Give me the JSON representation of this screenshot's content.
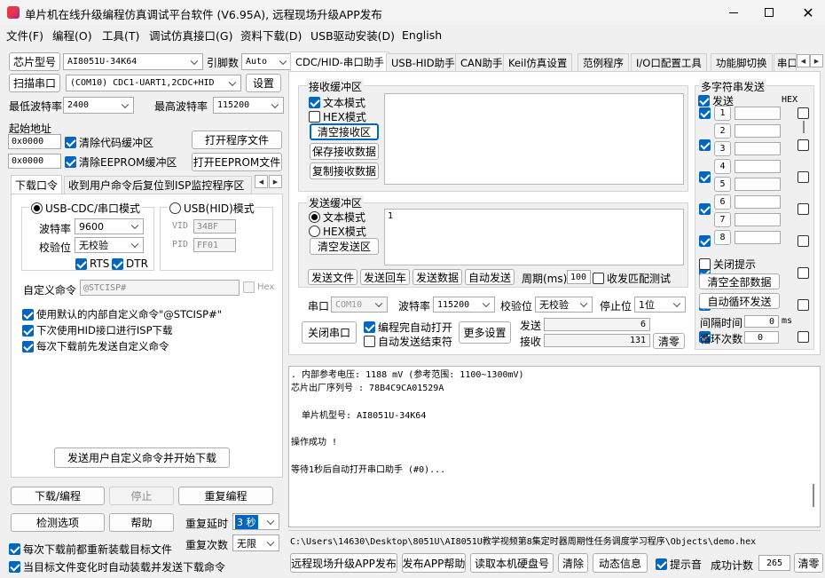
{
  "window": {
    "title": "单片机在线升级编程仿真调试平台软件 (V6.95A), 远程现场升级APP发布"
  },
  "menu": [
    "文件(F)",
    "编程(O)",
    "工具(T)",
    "调试仿真接口(G)",
    "资料下载(D)",
    "USB驱动安装(D)",
    "English"
  ],
  "left": {
    "chip_label": "芯片型号",
    "chip_value": "AI8051U-34K64",
    "pins_label": "引脚数",
    "pins_value": "Auto",
    "scan_label": "扫描串口",
    "port_value": "(COM10) CDC1-UART1,2CDC+HID",
    "settings_label": "设置",
    "min_baud_label": "最低波特率",
    "min_baud_value": "2400",
    "max_baud_label": "最高波特率",
    "max_baud_value": "115200",
    "start_addr_label": "起始地址",
    "addr1": "0x0000",
    "clear_code": "清除代码缓冲区",
    "open_prog": "打开程序文件",
    "addr2": "0x0000",
    "clear_eeprom": "清除EEPROM缓冲区",
    "open_eeprom": "打开EEPROM文件",
    "tabs": [
      "下载口令",
      "收到用户命令后复位到ISP监控程序区"
    ],
    "cdc_mode": "USB-CDC/串口模式",
    "hid_mode": "USB(HID)模式",
    "baud_label": "波特率",
    "baud_value": "9600",
    "parity_label": "校验位",
    "parity_value": "无校验",
    "rts": "RTS",
    "dtr": "DTR",
    "vid_label": "VID",
    "vid_value": "34BF",
    "pid_label": "PID",
    "pid_value": "FF01",
    "custom_cmd_label": "自定义命令",
    "custom_cmd_value": "@STCISP#",
    "hex_label": "Hex",
    "opt1": "使用默认的内部自定义命令\"@STCISP#\"",
    "opt2": "下次使用HID接口进行ISP下载",
    "opt3": "每次下载前先发送自定义命令",
    "send_start": "发送用户自定义命令并开始下载",
    "download": "下载/编程",
    "stop": "停止",
    "reprogram": "重复编程",
    "check": "检测选项",
    "help": "帮助",
    "delay_label": "重复延时",
    "delay_value": "3 秒",
    "count_label": "重复次数",
    "count_value": "无限",
    "reload": "每次下载前都重新装载目标文件",
    "auto_send": "当目标文件变化时自动装载并发送下载命令"
  },
  "tabs": [
    "CDC/HID-串口助手",
    "USB-HID助手",
    "CAN助手",
    "Keil仿真设置",
    "范例程序",
    "I/O口配置工具",
    "功能脚切换",
    "串口"
  ],
  "serial": {
    "recv_title": "接收缓冲区",
    "text_mode": "文本模式",
    "hex_mode": "HEX模式",
    "clear_recv": "清空接收区",
    "save_recv": "保存接收数据",
    "copy_recv": "复制接收数据",
    "send_title": "发送缓冲区",
    "send_text": "1",
    "clear_send": "清空发送区",
    "send_file": "发送文件",
    "send_back": "发送回车",
    "send_data": "发送数据",
    "auto_send": "自动发送",
    "period_label": "周期(ms)",
    "period_value": "100",
    "match_test": "收发匹配测试",
    "port_label": "串口",
    "port_value": "COM10",
    "baud_label": "波特率",
    "baud_value": "115200",
    "parity_label": "校验位",
    "parity_value": "无校验",
    "stop_label": "停止位",
    "stop_value": "1位",
    "close_port": "关闭串口",
    "auto_open": "编程完自动打开",
    "auto_end": "自动发送结束符",
    "more": "更多设置",
    "send_label": "发送",
    "send_count": "6",
    "recv_label": "接收",
    "recv_count": "131",
    "clear_counts": "清零"
  },
  "multi": {
    "title": "多字符串发送",
    "send_col": "发送",
    "hex_col": "HEX",
    "rows": [
      "1",
      "2",
      "3",
      "4",
      "5",
      "6",
      "7",
      "8"
    ],
    "close_tip": "关闭提示",
    "clear_all": "清空全部数据",
    "auto_loop": "自动循环发送",
    "interval_label": "间隔时间",
    "interval_value": "0",
    "interval_unit": "ms",
    "loop_label": "循环次数",
    "loop_value": "0"
  },
  "log": [
    ". 内部参考电压: 1188 mV (参考范围: 1100~1300mV)",
    "芯片出厂序列号 : 78B4C9CA01529A",
    "",
    "  单片机型号: AI8051U-34K64",
    "",
    "操作成功 !",
    "",
    "等待1秒后自动打开串口助手 (#0)..."
  ],
  "status": {
    "path": "C:\\Users\\14630\\Desktop\\8051U\\AI8051U教学视频第8集定时器周期性任务调度学习程序\\Objects\\demo.hex",
    "remote": "远程现场升级APP发布",
    "app_help": "发布APP帮助",
    "read_disk": "读取本机硬盘号",
    "clear": "清除",
    "dynamic": "动态信息",
    "beep": "提示音",
    "success_label": "成功计数",
    "success_value": "265",
    "reset": "清零"
  }
}
